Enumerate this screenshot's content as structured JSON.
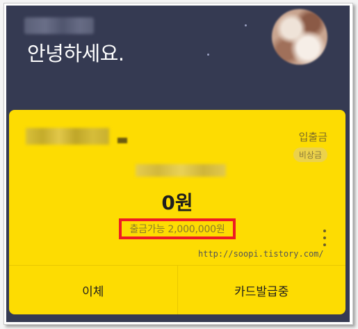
{
  "header": {
    "greeting": "안녕하세요."
  },
  "account_card": {
    "inout_link": "입출금",
    "emergency_badge": "비상금",
    "balance": "0원",
    "withdrawable": "출금가능 2,000,000원"
  },
  "watermark": "http://soopi.tistory.com/",
  "actions": {
    "transfer": "이체",
    "card_issue": "카드발급중"
  },
  "colors": {
    "background": "#353a52",
    "card": "#fddc02",
    "highlight_border": "#ee1c24"
  }
}
